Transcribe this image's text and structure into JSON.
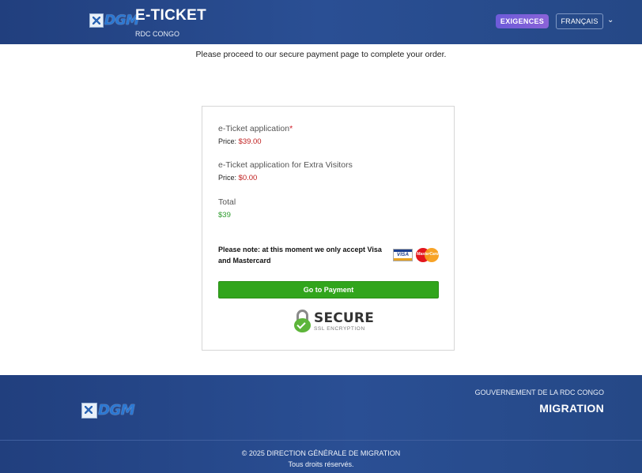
{
  "header": {
    "logo_text": "DGM",
    "title": "E-TICKET",
    "subtitle": "RDC CONGO",
    "requirements_button": "EXIGENCES",
    "language_select": "FRANÇAIS",
    "chevron_glyph": "⌄"
  },
  "main": {
    "intro": "Please proceed to our secure payment page to complete your order.",
    "items": [
      {
        "label": "e-Ticket application",
        "required_mark": "*",
        "price_prefix": "Price:",
        "price": "$39.00"
      },
      {
        "label": "e-Ticket application for Extra Visitors",
        "price_prefix": "Price:",
        "price": "$0.00"
      }
    ],
    "total_label": "Total",
    "total_value": "$39",
    "note": "Please note: at this moment we only accept Visa and Mastercard",
    "card_icons": [
      "visa-icon",
      "mastercard-icon"
    ],
    "visa_text": "VISA",
    "mastercard_text": "MasterCard",
    "payment_button": "Go to Payment",
    "secure_badge": {
      "title": "SECURE",
      "subtitle": "SSL ENCRYPTION"
    }
  },
  "footer": {
    "logo_text": "DGM",
    "government": "GOUVERNEMENT DE LA RDC CONGO",
    "department": "MIGRATION",
    "copyright": "© 2025 DIRECTION GÉNÉRALE DE MIGRATION",
    "rights": "Tous droits réservés."
  },
  "colors": {
    "header_bg": "#2a4f94",
    "requirements_button": "#7a5fd9",
    "price_red": "#c02020",
    "total_green": "#2a9a2a",
    "payment_green": "#31a51c"
  }
}
